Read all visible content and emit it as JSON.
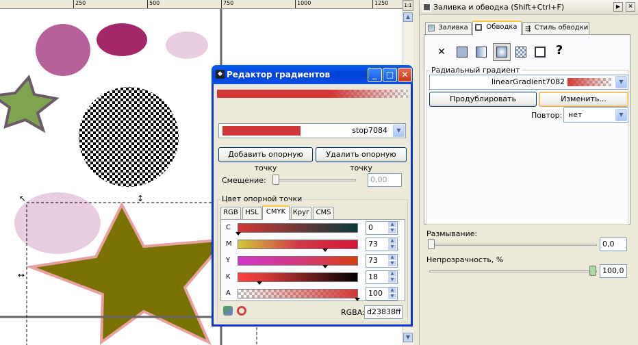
{
  "ruler": {
    "ticks": [
      "250",
      "500",
      "750",
      "1000",
      "1250"
    ]
  },
  "zoom_label": "1:1",
  "gradient_editor": {
    "title": "Редактор градиентов",
    "stop_combo_value": "stop7084",
    "add_stop_label": "Добавить опорную точку",
    "delete_stop_label": "Удалить опорную точку",
    "offset_label": "Смещение:",
    "offset_value": "0,00",
    "stop_color_label": "Цвет опорной точки",
    "tabs": [
      "RGB",
      "HSL",
      "CMYK",
      "Круг",
      "CMS"
    ],
    "active_tab": "CMYK",
    "channels": [
      {
        "label": "C",
        "value": "0",
        "fraction": 0.0
      },
      {
        "label": "M",
        "value": "73",
        "fraction": 0.73
      },
      {
        "label": "Y",
        "value": "73",
        "fraction": 0.73
      },
      {
        "label": "K",
        "value": "18",
        "fraction": 0.18
      },
      {
        "label": "A",
        "value": "100",
        "fraction": 1.0
      }
    ],
    "rgba_label": "RGBA:",
    "rgba_value": "d23838ff",
    "accent_color": "#d23838"
  },
  "fill_stroke": {
    "title": "Заливка и обводка (Shift+Ctrl+F)",
    "tabs": [
      "Заливка",
      "Обводка",
      "Стиль обводки"
    ],
    "active_tab": "Обводка",
    "gradient_type_label": "Радиальный градиент",
    "gradient_name": "linearGradient7082",
    "duplicate_label": "Продублировать",
    "edit_label": "Изменить...",
    "repeat_label": "Повтор:",
    "repeat_value": "нет",
    "blur_label": "Размывание:",
    "blur_value": "0,0",
    "opacity_label": "Непрозрачность, %",
    "opacity_value": "100,0",
    "opacity_fraction": 1.0,
    "blur_fraction": 0.0
  },
  "canvas_colors": {
    "magenta_light": "#b8609a",
    "magenta_dark": "#a3286b",
    "pink_pale": "#e9cde0",
    "star_green": "#7fa44f",
    "star_olive": "#7a7200",
    "star_outline": "#e8a0a0"
  }
}
